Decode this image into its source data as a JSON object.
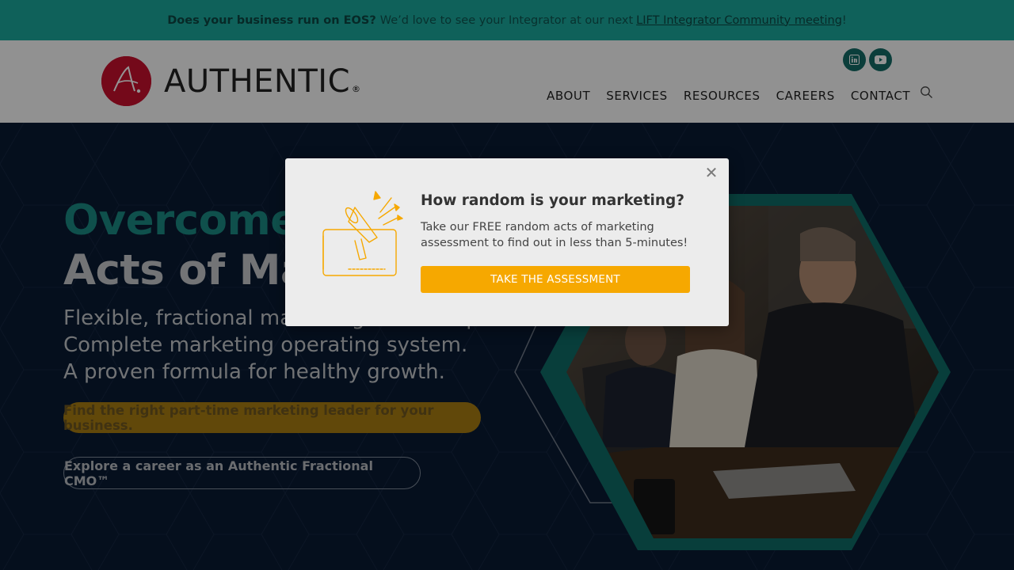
{
  "announcement": {
    "bold_text": "Does your business run on EOS?",
    "text": "We’d love to see your Integrator at our next",
    "link_text": "LIFT Integrator Community meeting",
    "suffix": "!"
  },
  "header": {
    "logo_text": "AUTHENTIC",
    "logo_reg": "®",
    "social_icons": [
      "linkedin-icon",
      "youtube-icon"
    ],
    "nav": [
      "ABOUT",
      "SERVICES",
      "RESOURCES",
      "CAREERS",
      "CONTACT"
    ],
    "search_icon": "search-icon"
  },
  "hero": {
    "headline_teal": "Overcome R",
    "headline_grey_line1_rest": "",
    "headline_line2": "Acts of Mar",
    "sub_lines": [
      "Flexible, fractional marketing leadership.",
      "Complete marketing operating system.",
      "A proven formula for healthy growth."
    ],
    "cta_primary": "Find the right part-time marketing leader for your business.",
    "cta_secondary": "Explore a career as an Authentic Fractional CMO™"
  },
  "modal": {
    "title": "How random is your marketing?",
    "text": "Take our FREE random acts of marketing assessment to find out in less than 5-minutes!",
    "button": "TAKE THE ASSESSMENT",
    "close_icon": "close-icon",
    "illustration_icon": "megaphone-icon"
  },
  "colors": {
    "teal_bar": "#1aa79b",
    "brand_red": "#c8102e",
    "hero_bg": "#0a1a33",
    "accent_orange": "#f6a800",
    "teal_dark": "#136b66"
  }
}
